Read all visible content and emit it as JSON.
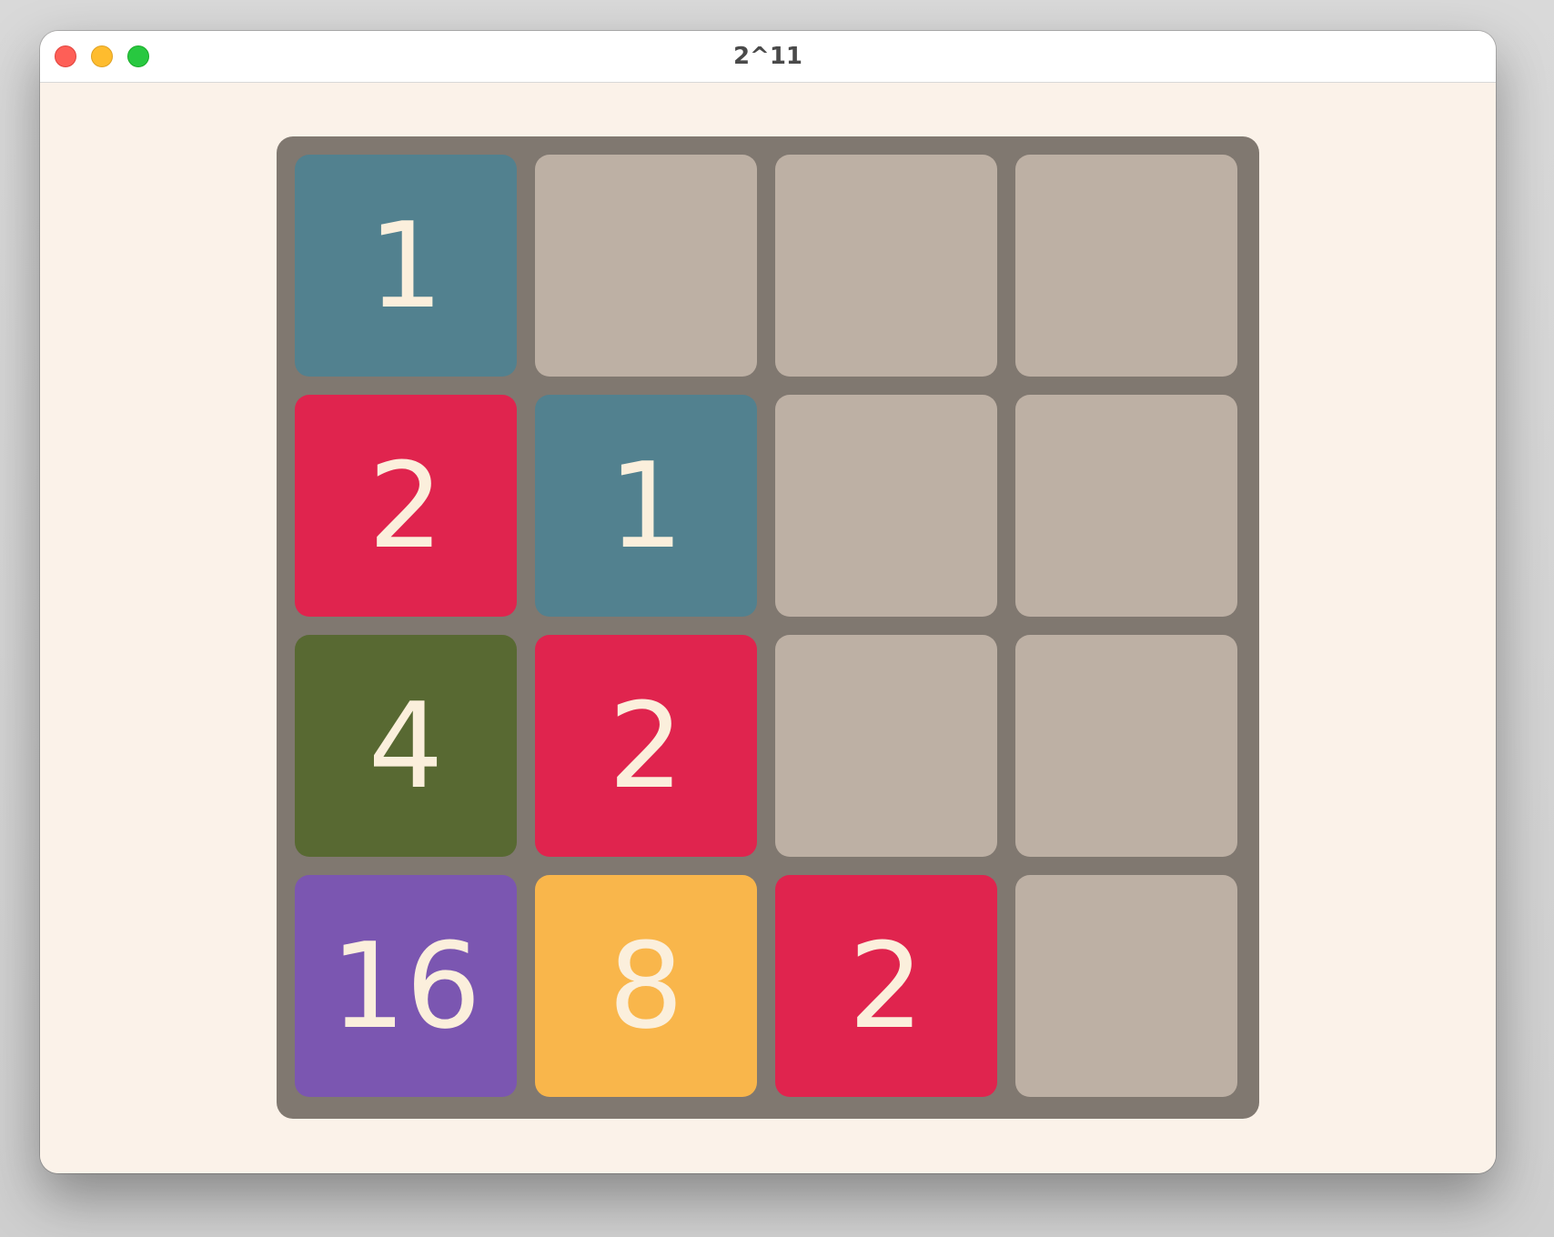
{
  "window": {
    "title": "2^11"
  },
  "board": {
    "rows": 4,
    "cols": 4,
    "cells": [
      [
        1,
        null,
        null,
        null
      ],
      [
        2,
        1,
        null,
        null
      ],
      [
        4,
        2,
        null,
        null
      ],
      [
        16,
        8,
        2,
        null
      ]
    ]
  },
  "colors": {
    "empty": "#bdb0a4",
    "board": "#807870",
    "background": "#fbf2e9",
    "text": "#fbefdc",
    "1": "#52818f",
    "2": "#e0244e",
    "4": "#586932",
    "8": "#f9b64b",
    "16": "#7b56b1"
  }
}
